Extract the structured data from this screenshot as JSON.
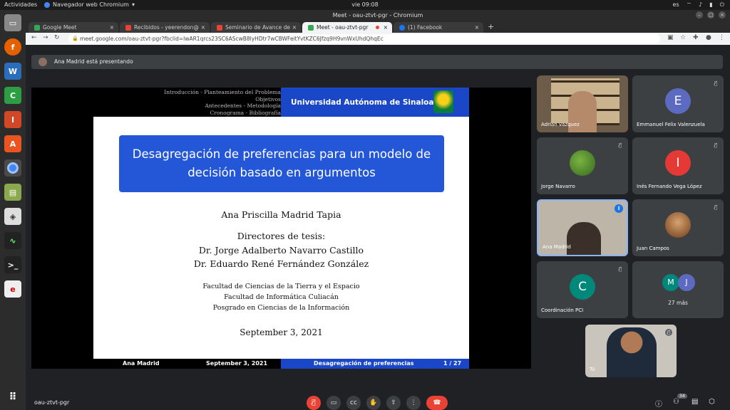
{
  "topbar": {
    "activities": "Actividades",
    "app_menu": "Navegador web Chromium",
    "clock": "vie 09:08",
    "lang": "es"
  },
  "window": {
    "title": "Meet - oau-ztvt-pgr - Chromium"
  },
  "tabs": [
    {
      "label": "Google Meet",
      "fav_color": "#34a853"
    },
    {
      "label": "Recibidos - yeerendon@",
      "fav_color": "#ea4335"
    },
    {
      "label": "Seminario de Avance de",
      "fav_color": "#ea4335"
    },
    {
      "label": "Meet - oau-ztvt-pgr",
      "fav_color": "#34a853"
    },
    {
      "label": "(1) Facebook",
      "fav_color": "#1877f2"
    }
  ],
  "omnibox": {
    "url": "meet.google.com/oau-ztvt-pgr?fbclid=IwAR1qrcs23SC6AScwB8lyHDtr7wCBWFeitYvtKZC6Jfzq9H9vnWxUhdQhqEc"
  },
  "presenting": {
    "text": "Ana Madrid está presentando"
  },
  "slide": {
    "nav_lines": [
      "Introducción - Planteamiento del Problema",
      "Objetivos",
      "Antecedentes - Metodología",
      "Cronograma - Bibliografía"
    ],
    "university": "Universidad Autónoma de Sinaloa",
    "title": "Desagregación de preferencias para un modelo de decisión basado en argumentos",
    "author": "Ana Priscilla Madrid Tapia",
    "directors_label": "Directores de tesis:",
    "director_1": "Dr. Jorge Adalberto Navarro Castillo",
    "director_2": "Dr. Eduardo René Fernández González",
    "faculty_1": "Facultad de Ciencias de la Tierra y el Espacio",
    "faculty_2": "Facultad de Informática Culiacán",
    "faculty_3": "Posgrado en Ciencias de la Información",
    "date": "September 3, 2021",
    "footer_author": "Ana Madrid",
    "footer_date": "September 3, 2021",
    "footer_short_title": "Desagregación de preferencias",
    "footer_page": "1 / 27"
  },
  "participants": [
    {
      "name": "Adrian vazquez"
    },
    {
      "name": "Emmanuel Felix Valenzuela",
      "initial": "E",
      "color": "#5c6bc0"
    },
    {
      "name": "Jorge Navarro"
    },
    {
      "name": "Inés Fernando Vega López",
      "initial": "I",
      "color": "#e53935"
    },
    {
      "name": "Ana Madrid"
    },
    {
      "name": "Juan Campos"
    },
    {
      "name": "Coordinación PCI",
      "initial": "C",
      "color": "#00897b"
    },
    {
      "name": "27 más",
      "initial_1": "M",
      "initial_2": "J",
      "color_1": "#00897b",
      "color_2": "#5c6bc0"
    }
  ],
  "self_tile": {
    "name": "Tú"
  },
  "bottom": {
    "meeting_code": "oau-ztvt-pgr",
    "people_count": "34"
  }
}
